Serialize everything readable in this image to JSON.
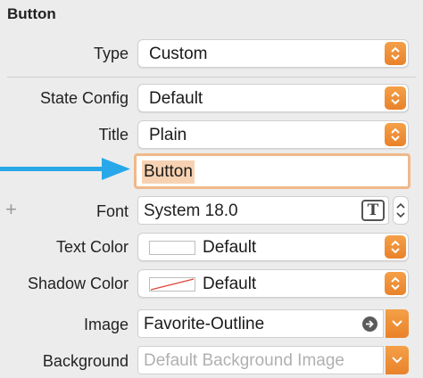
{
  "section": {
    "title": "Button"
  },
  "fields": {
    "type": {
      "label": "Type",
      "value": "Custom"
    },
    "state_config": {
      "label": "State Config",
      "value": "Default"
    },
    "title_style": {
      "label": "Title",
      "value": "Plain"
    },
    "title_text": {
      "value": "Button"
    },
    "font": {
      "label": "Font",
      "value": "System 18.0",
      "edit_glyph": "T",
      "add_glyph": "+"
    },
    "text_color": {
      "label": "Text Color",
      "value": "Default",
      "swatch_color": "#ffffff"
    },
    "shadow_color": {
      "label": "Shadow Color",
      "value": "Default",
      "swatch": "none-slash"
    },
    "image": {
      "label": "Image",
      "value": "Favorite-Outline"
    },
    "background": {
      "label": "Background",
      "placeholder": "Default Background Image"
    }
  },
  "colors": {
    "accent_orange": "#ed8a30",
    "arrow_blue": "#28a8e8",
    "selection": "#f7d2b2",
    "focus_ring": "#f0b889"
  }
}
